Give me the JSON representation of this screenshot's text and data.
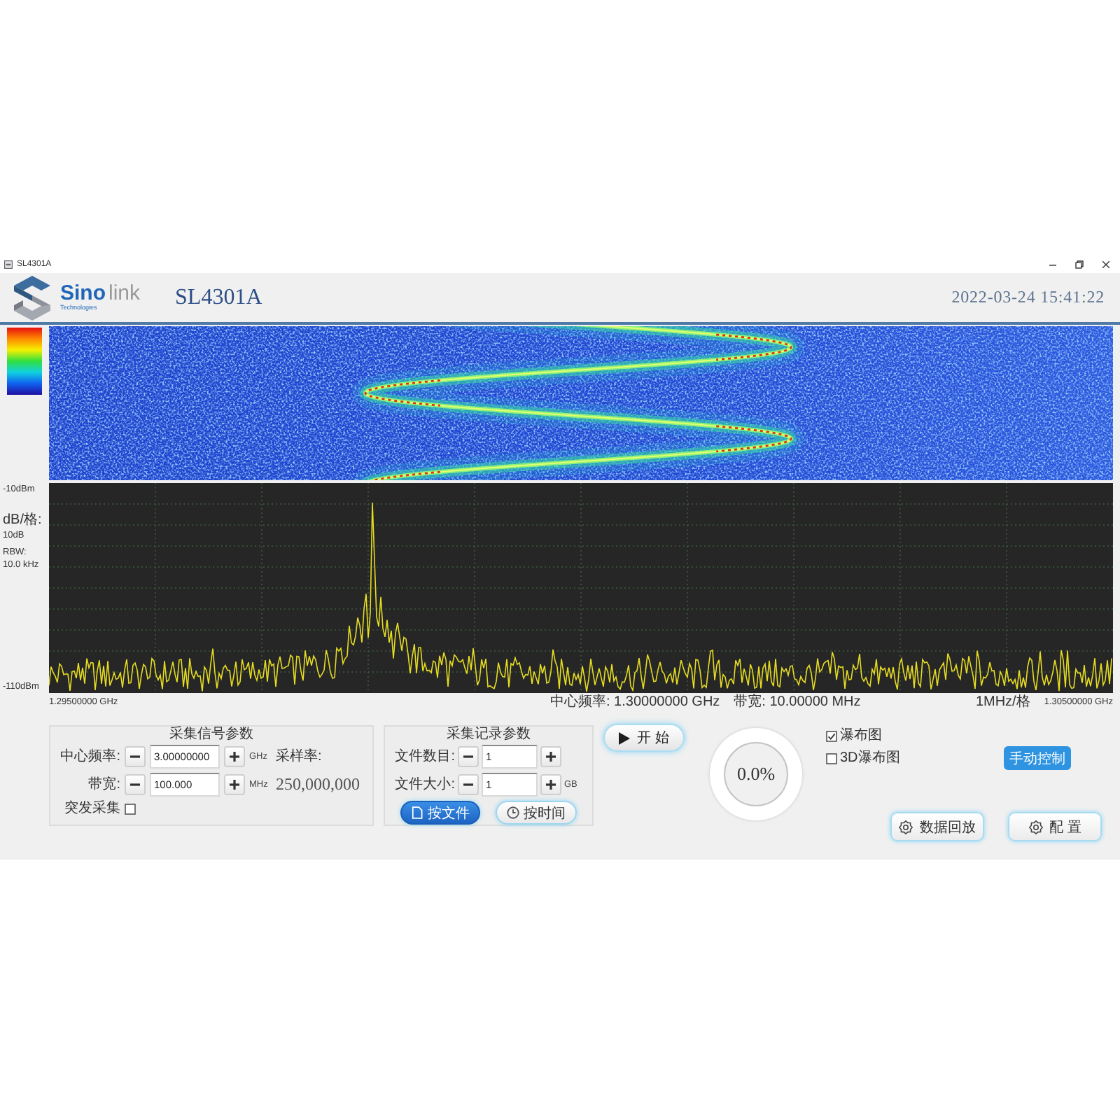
{
  "window": {
    "title": "SL4301A"
  },
  "header": {
    "logo": {
      "brand_left": "Sino",
      "brand_right": "link",
      "tagline": "Technologies"
    },
    "model": "SL4301A",
    "datetime": "2022-03-24 15:41:22"
  },
  "spectrum": {
    "ref_level": "-10dBm",
    "scale_label": "dB/格:",
    "scale": "10dB",
    "rbw_label": "RBW:",
    "rbw": "10.0 kHz",
    "bottom_level": "-110dBm"
  },
  "freq_axis": {
    "start": "1.29500000 GHz",
    "center": "中心频率: 1.30000000 GHz",
    "span": "带宽: 10.00000 MHz",
    "per_div": "1MHz/格",
    "stop": "1.30500000 GHz"
  },
  "signal_params": {
    "title": "采集信号参数",
    "fields": [
      {
        "label": "中心频率:",
        "value": "3.00000000",
        "unit": "GHz"
      },
      {
        "label": "带宽:",
        "value": "100.000",
        "unit": "MHz"
      }
    ],
    "sample_rate_label": "采样率:",
    "sample_rate": "250,000,000",
    "burst": {
      "label": "突发采集",
      "checked": false
    }
  },
  "record_params": {
    "title": "采集记录参数",
    "fields": [
      {
        "label": "文件数目:",
        "value": "1"
      },
      {
        "label": "文件大小:",
        "value": "1",
        "unit": "GB"
      }
    ],
    "modes": [
      {
        "kind": "file",
        "label": "按文件",
        "selected": true
      },
      {
        "kind": "clock",
        "label": "按时间",
        "selected": false
      }
    ]
  },
  "start_button": {
    "label": "开 始"
  },
  "progress": {
    "text": "0.0%"
  },
  "views": [
    {
      "label": "瀑布图",
      "checked": true
    },
    {
      "label": "3D瀑布图",
      "checked": false
    }
  ],
  "manual_button": {
    "label": "手动控制"
  },
  "actions": [
    {
      "label": "数据回放"
    },
    {
      "label": "配 置"
    }
  ]
}
